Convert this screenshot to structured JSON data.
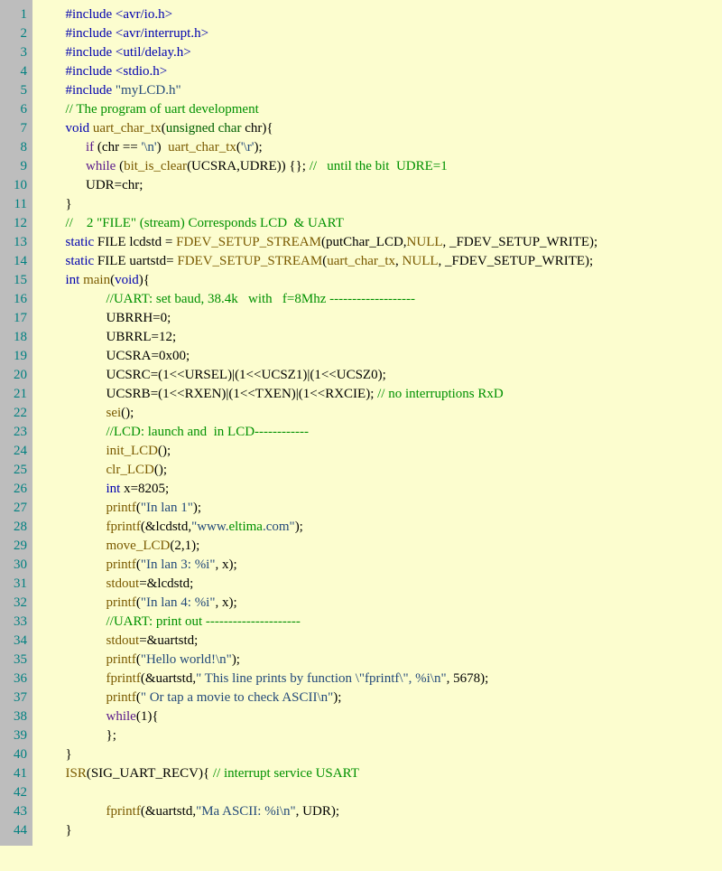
{
  "lines": [
    {
      "n": 1,
      "indent": 1,
      "html": "<span class='pp'>#include</span> <span class='inc'>&lt;avr/io.h&gt;</span>"
    },
    {
      "n": 2,
      "indent": 1,
      "html": "<span class='pp'>#include</span> <span class='inc'>&lt;avr/interrupt.h&gt;</span>"
    },
    {
      "n": 3,
      "indent": 1,
      "html": "<span class='pp'>#include</span> <span class='inc'>&lt;util/delay.h&gt;</span>"
    },
    {
      "n": 4,
      "indent": 1,
      "html": "<span class='pp'>#include</span> <span class='inc'>&lt;stdio.h&gt;</span>"
    },
    {
      "n": 5,
      "indent": 1,
      "html": "<span class='pp'>#include</span> <span class='str'>\"myLCD.h\"</span>"
    },
    {
      "n": 6,
      "indent": 1,
      "html": "<span class='cm'>// The program of uart development</span>"
    },
    {
      "n": 7,
      "indent": 1,
      "html": "<span class='kw'>void</span> <span class='fn'>uart_char_tx</span>(<span class='type'>unsigned char</span> chr){"
    },
    {
      "n": 8,
      "indent": 2,
      "html": "<span class='kw2'>if</span> (chr == <span class='str'>'\\n'</span>)  <span class='fn'>uart_char_tx</span>(<span class='str'>'\\r'</span>);"
    },
    {
      "n": 9,
      "indent": 2,
      "html": "<span class='kw2'>while</span> (<span class='fn'>bit_is_clear</span>(UCSRA,UDRE)) {}; <span class='cm'>//   until the bit  UDRE=1</span>"
    },
    {
      "n": 10,
      "indent": 2,
      "html": "UDR=chr;"
    },
    {
      "n": 11,
      "indent": 1,
      "html": "}"
    },
    {
      "n": 12,
      "indent": 1,
      "html": "<span class='cm'>//    2 \"FILE\" (stream) Corresponds LCD  &amp; UART</span>"
    },
    {
      "n": 13,
      "indent": 1,
      "html": "<span class='kw'>static</span> FILE lcdstd = <span class='mac'>FDEV_SETUP_STREAM</span>(putChar_LCD,<span class='null'>NULL</span>, _FDEV_SETUP_WRITE);"
    },
    {
      "n": 14,
      "indent": 1,
      "html": "<span class='kw'>static</span> FILE uartstd= <span class='mac'>FDEV_SETUP_STREAM</span>(<span class='fn'>uart_char_tx</span>, <span class='null'>NULL</span>, _FDEV_SETUP_WRITE);"
    },
    {
      "n": 15,
      "indent": 1,
      "html": "<span class='kw'>int</span> <span class='fn'>main</span>(<span class='kw'>void</span>){"
    },
    {
      "n": 16,
      "indent": 3,
      "html": "<span class='cm'>//UART: set baud, 38.4k   with   f=8Mhz -------------------</span>"
    },
    {
      "n": 17,
      "indent": 3,
      "html": "UBRRH=0;"
    },
    {
      "n": 18,
      "indent": 3,
      "html": "UBRRL=12;"
    },
    {
      "n": 19,
      "indent": 3,
      "html": "UCSRA=0x00;"
    },
    {
      "n": 20,
      "indent": 3,
      "html": "UCSRC=(1&lt;&lt;URSEL)|(1&lt;&lt;UCSZ1)|(1&lt;&lt;UCSZ0);"
    },
    {
      "n": 21,
      "indent": 3,
      "html": "UCSRB=(1&lt;&lt;RXEN)|(1&lt;&lt;TXEN)|(1&lt;&lt;RXCIE); <span class='cm'>// no interruptions RxD</span>"
    },
    {
      "n": 22,
      "indent": 3,
      "html": "<span class='fn'>sei</span>();"
    },
    {
      "n": 23,
      "indent": 3,
      "html": "<span class='cm'>//LCD: launch and  in LCD------------</span>"
    },
    {
      "n": 24,
      "indent": 3,
      "html": "<span class='fn'>init_LCD</span>();"
    },
    {
      "n": 25,
      "indent": 3,
      "html": "<span class='fn'>clr_LCD</span>();"
    },
    {
      "n": 26,
      "indent": 3,
      "html": "<span class='kw'>int</span> x=8205;"
    },
    {
      "n": 27,
      "indent": 3,
      "html": "<span class='fn'>printf</span>(<span class='str'>\"In lan 1\"</span>);"
    },
    {
      "n": 28,
      "indent": 3,
      "html": "<span class='fn'>fprintf</span>(&amp;lcdstd,<span class='str'>\"www.</span><span class='cm'>eltima</span><span class='str'>.com\"</span>);"
    },
    {
      "n": 29,
      "indent": 3,
      "html": "<span class='fn'>move_LCD</span>(2,1);"
    },
    {
      "n": 30,
      "indent": 3,
      "html": "<span class='fn'>printf</span>(<span class='str'>\"In lan 3: %i\"</span>, x);"
    },
    {
      "n": 31,
      "indent": 3,
      "html": "<span class='fn'>stdout</span>=&amp;lcdstd;"
    },
    {
      "n": 32,
      "indent": 3,
      "html": "<span class='fn'>printf</span>(<span class='str'>\"In lan 4: %i\"</span>, x);"
    },
    {
      "n": 33,
      "indent": 3,
      "html": "<span class='cm'>//UART: print out ---------------------</span>"
    },
    {
      "n": 34,
      "indent": 3,
      "html": "<span class='fn'>stdout</span>=&amp;uartstd;"
    },
    {
      "n": 35,
      "indent": 3,
      "html": "<span class='fn'>printf</span>(<span class='str'>\"Hello world!\\n\"</span>);"
    },
    {
      "n": 36,
      "indent": 3,
      "html": "<span class='fn'>fprintf</span>(&amp;uartstd,<span class='str'>\" This line prints by function \\\"fprintf\\\", %i\\n\"</span>, 5678);"
    },
    {
      "n": 37,
      "indent": 3,
      "html": "<span class='fn'>printf</span>(<span class='str'>\" Or tap a movie to check ASCII\\n\"</span>);"
    },
    {
      "n": 38,
      "indent": 3,
      "html": "<span class='kw2'>while</span>(1){"
    },
    {
      "n": 39,
      "indent": 3,
      "html": "};"
    },
    {
      "n": 40,
      "indent": 1,
      "html": "}"
    },
    {
      "n": 41,
      "indent": 1,
      "html": "<span class='fn'>ISR</span>(SIG_UART_RECV){ <span class='cm'>// interrupt service USART</span>"
    },
    {
      "n": 42,
      "indent": 3,
      "html": ""
    },
    {
      "n": 43,
      "indent": 3,
      "html": "<span class='fn'>fprintf</span>(&amp;uartstd,<span class='str'>\"Ma ASCII: %i\\n\"</span>, UDR);"
    },
    {
      "n": 44,
      "indent": 1,
      "html": "}"
    }
  ],
  "indentUnit": "      "
}
